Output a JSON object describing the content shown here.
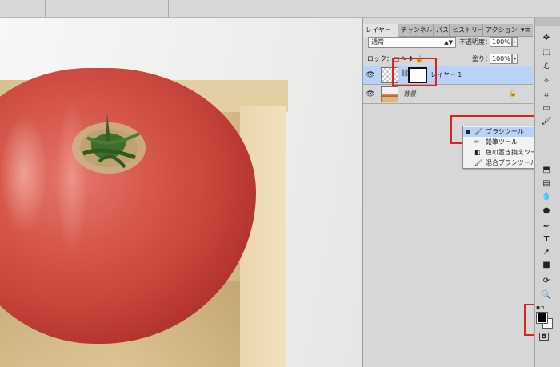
{
  "panel": {
    "tabs": [
      "レイヤー",
      "チャンネル",
      "パス",
      "ヒストリー",
      "アクション"
    ],
    "tab_menu_icon": "panel-menu-icon",
    "blend_mode": "通常",
    "opacity_label": "不透明度：",
    "opacity_value": "100%",
    "lock_label": "ロック：",
    "fill_label": "塗り：",
    "fill_value": "100%",
    "layers": [
      {
        "name": "レイヤー 1",
        "selected": true,
        "has_mask": true
      },
      {
        "name": "背景",
        "selected": false,
        "locked": true
      }
    ]
  },
  "flyout": {
    "items": [
      {
        "label": "ブラシツール",
        "key": "B",
        "selected": true,
        "icon": "brush-icon"
      },
      {
        "label": "鉛筆ツール",
        "key": "B",
        "selected": false,
        "icon": "pencil-icon"
      },
      {
        "label": "色の置き換えツール",
        "key": "B",
        "selected": false,
        "icon": "color-replace-icon"
      },
      {
        "label": "混合ブラシツール",
        "key": "B",
        "selected": false,
        "icon": "mixer-brush-icon"
      }
    ]
  },
  "tools": {
    "foreground_color": "#000000",
    "background_color": "#ffffff"
  },
  "colors": {
    "highlight_box": "#e0201b",
    "selection": "#b8d3f7"
  }
}
